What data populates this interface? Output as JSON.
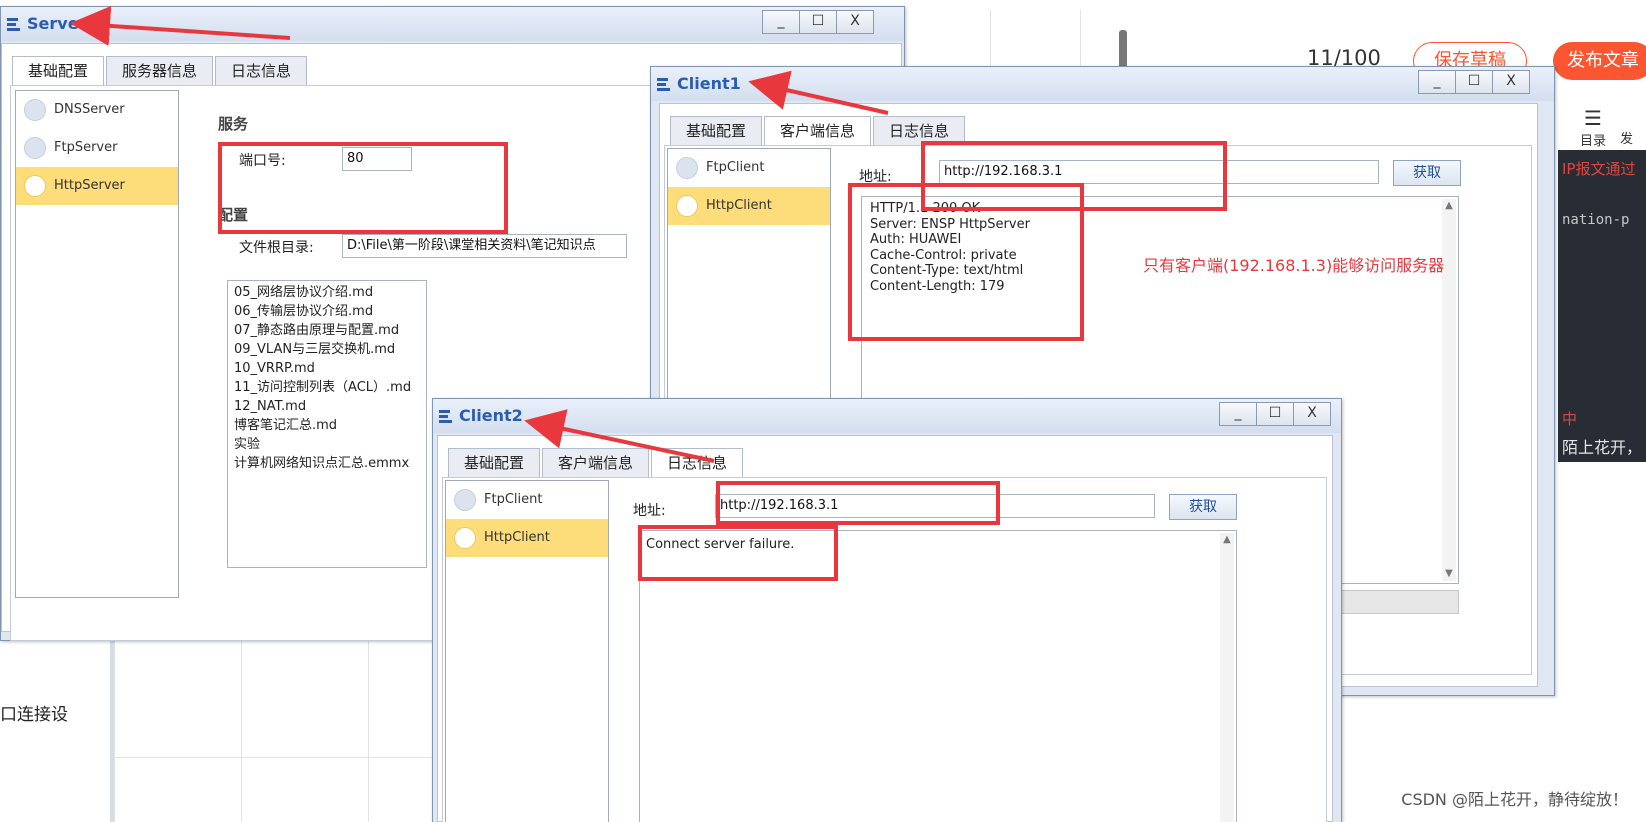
{
  "background": {
    "editor": {
      "word_count": "11/100",
      "save_draft": "保存草稿",
      "publish": "发布文章",
      "toc_icon": "list-icon",
      "toc_label": "目录",
      "publish_short": "发",
      "code_line1": "IP报文通过",
      "code_line2": "nation-p",
      "code_line3": "中",
      "code_line4": "陌上花开，"
    },
    "topology_text": "口连接设",
    "watermark": "CSDN @陌上花开，静待绽放！"
  },
  "server": {
    "title": "Server1",
    "tabs": [
      "基础配置",
      "服务器信息",
      "日志信息"
    ],
    "services": [
      {
        "label": "DNSServer",
        "selected": false
      },
      {
        "label": "FtpServer",
        "selected": false
      },
      {
        "label": "HttpServer",
        "selected": true
      }
    ],
    "service_group": "服务",
    "port_label": "端口号:",
    "port_value": "80",
    "config_group": "配置",
    "root_label": "文件根目录:",
    "root_value": "D:\\File\\第一阶段\\课堂相关资料\\笔记知识点",
    "files": [
      "05_网络层协议介绍.md",
      "06_传输层协议介绍.md",
      "07_静态路由原理与配置.md",
      "09_VLAN与三层交换机.md",
      "10_VRRP.md",
      "11_访问控制列表（ACL）.md",
      "12_NAT.md",
      "博客笔记汇总.md",
      "实验",
      "计算机网络知识点汇总.emmx"
    ]
  },
  "client1": {
    "title": "Client1",
    "tabs": [
      "基础配置",
      "客户端信息",
      "日志信息"
    ],
    "clients": [
      {
        "label": "FtpClient",
        "selected": false
      },
      {
        "label": "HttpClient",
        "selected": true
      }
    ],
    "address_label": "地址:",
    "address_value": "http://192.168.3.1",
    "get_button": "获取",
    "response": [
      "HTTP/1.1 200 OK",
      "Server: ENSP HttpServer",
      "Auth: HUAWEI",
      "Cache-Control: private",
      "Content-Type: text/html",
      "Content-Length: 179"
    ]
  },
  "client2": {
    "title": "Client2",
    "tabs": [
      "基础配置",
      "客户端信息",
      "日志信息"
    ],
    "clients": [
      {
        "label": "FtpClient",
        "selected": false
      },
      {
        "label": "HttpClient",
        "selected": true
      }
    ],
    "address_label": "地址:",
    "address_value": "http://192.168.3.1",
    "get_button": "获取",
    "response": "Connect server failure."
  },
  "annotation": "只有客户端(192.168.1.3)能够访问服务器",
  "window_controls": {
    "minimize": "_",
    "maximize": "☐",
    "close": "X"
  },
  "colors": {
    "annotation_red": "#e8383d",
    "title_blue": "#2a5db0",
    "selected_item": "#fddc7a",
    "csdn_orange": "#fc5531"
  }
}
